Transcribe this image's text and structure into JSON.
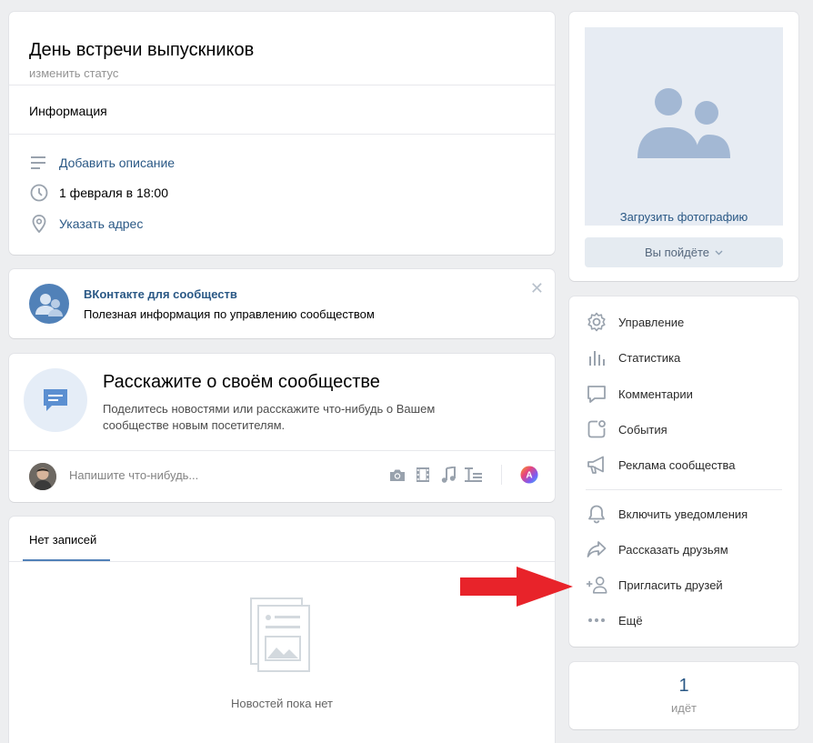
{
  "header": {
    "title": "День встречи выпускников",
    "status_link": "изменить статус",
    "info_tab": "Информация",
    "rows": [
      {
        "icon": "lines-icon",
        "text": "Добавить описание",
        "is_link": true
      },
      {
        "icon": "clock-icon",
        "text": "1 февраля в 18:00",
        "is_link": false
      },
      {
        "icon": "location-pin-icon",
        "text": "Указать адрес",
        "is_link": true
      }
    ]
  },
  "promo": {
    "title": "ВКонтакте для сообществ",
    "subtitle": "Полезная информация по управлению сообществом",
    "close_icon": "close-icon"
  },
  "tell": {
    "title": "Расскажите о своём сообществе",
    "text": "Поделитесь новостями или расскажите что-нибудь о Вашем сообществе новым посетителям.",
    "composer_placeholder": "Напишите что-нибудь...",
    "tools": [
      "camera-icon",
      "video-icon",
      "music-icon",
      "text-format-icon",
      "poster-icon"
    ]
  },
  "posts": {
    "tab": "Нет записей",
    "empty_text": "Новостей пока нет"
  },
  "photo": {
    "upload_label": "Загрузить фотографию",
    "going_button": "Вы пойдёте"
  },
  "menu": {
    "items": [
      {
        "icon": "gear-icon",
        "label": "Управление"
      },
      {
        "icon": "stats-icon",
        "label": "Статистика"
      },
      {
        "icon": "comment-icon",
        "label": "Комментарии"
      },
      {
        "icon": "events-icon",
        "label": "События"
      },
      {
        "icon": "megaphone-icon",
        "label": "Реклама сообщества"
      },
      {
        "icon": "bell-icon",
        "label": "Включить уведомления"
      },
      {
        "icon": "share-icon",
        "label": "Рассказать друзьям"
      },
      {
        "icon": "add-user-icon",
        "label": "Пригласить друзей"
      },
      {
        "icon": "more-icon",
        "label": "Ещё"
      }
    ]
  },
  "attendees": {
    "count": "1",
    "label": "идёт"
  },
  "colors": {
    "accent": "#2a5885",
    "background": "#edeef0",
    "arrow": "#e8232a"
  }
}
